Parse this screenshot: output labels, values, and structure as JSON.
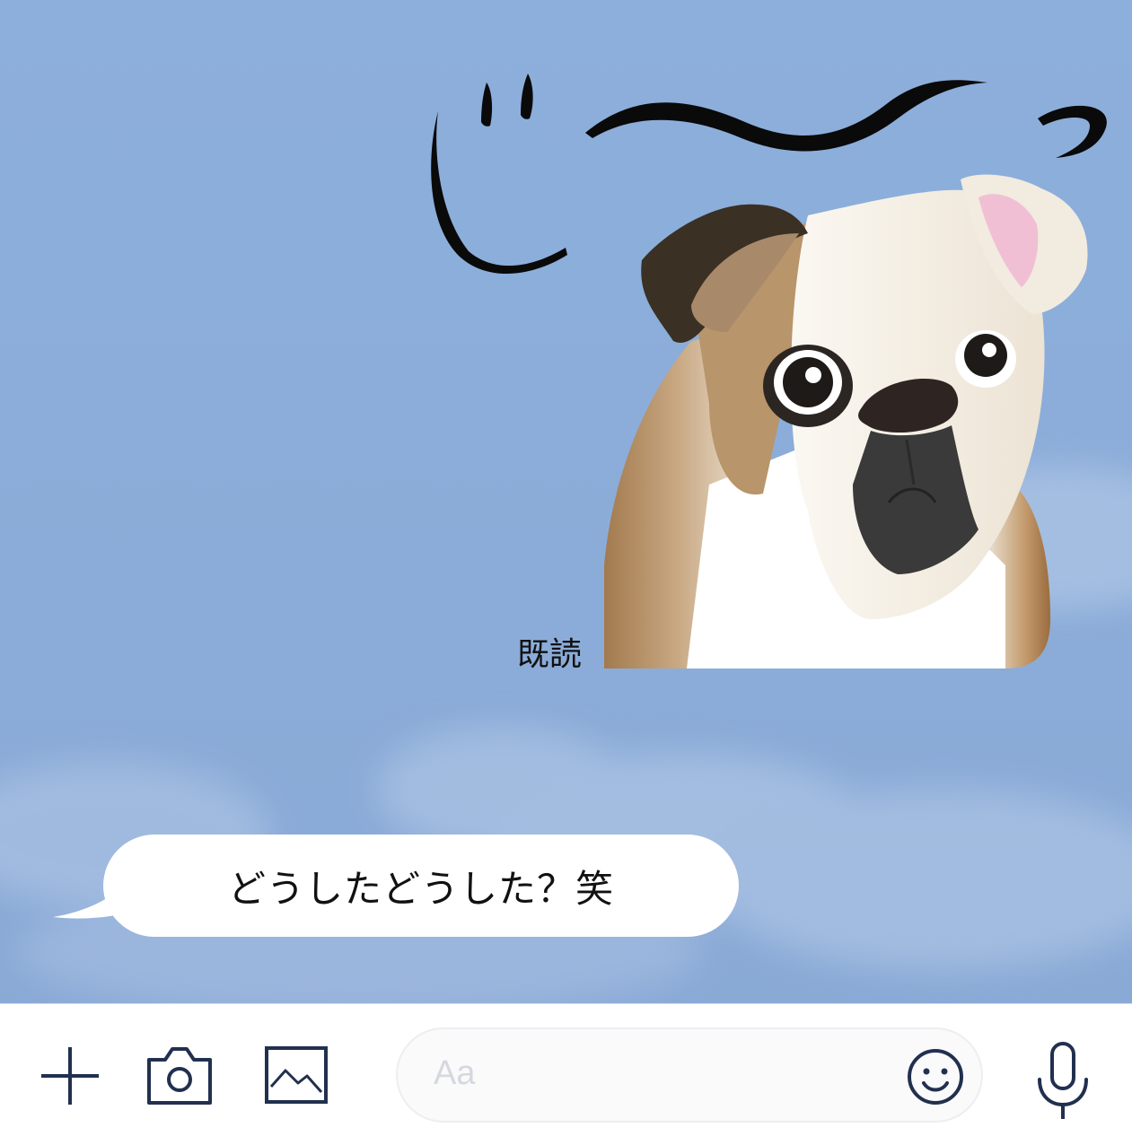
{
  "chat": {
    "sticker": {
      "caption": "じ〜っ",
      "read_receipt": "既読"
    },
    "incoming_message": {
      "text": "どうしたどうした？笑"
    }
  },
  "toolbar": {
    "input_placeholder": "Aa",
    "icons": [
      "plus-icon",
      "camera-icon",
      "image-icon",
      "smile-icon",
      "microphone-icon"
    ]
  },
  "colors": {
    "chat_background": "#8fb0d9",
    "bubble": "#ffffff",
    "toolbar_icon": "#22304f"
  }
}
